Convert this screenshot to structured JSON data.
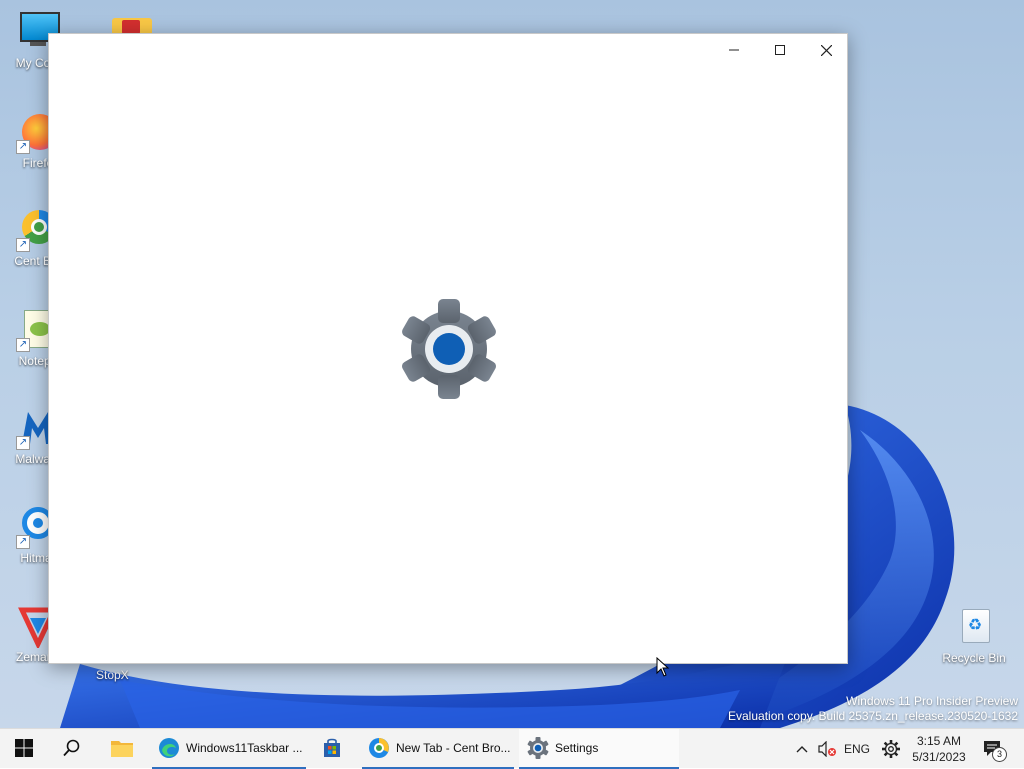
{
  "desktop": {
    "icons": [
      {
        "label": "My Com",
        "icon": "computer-icon"
      },
      {
        "label": "Firefo",
        "icon": "firefox-icon"
      },
      {
        "label": "Cent Bro",
        "icon": "cent-browser-icon"
      },
      {
        "label": "Notepa",
        "icon": "notepad-icon"
      },
      {
        "label": "Malware",
        "icon": "malwarebytes-icon"
      },
      {
        "label": "Hitmar",
        "icon": "hitmanpro-icon"
      },
      {
        "label": "Zemana",
        "icon": "zemana-icon"
      },
      {
        "label": "StopX",
        "icon": "folder-icon"
      },
      {
        "label": "Recycle Bin",
        "icon": "recycle-bin-icon"
      }
    ],
    "watermark": {
      "line1": "Windows 11 Pro Insider Preview",
      "line2": "Evaluation copy. Build 25375.zn_release.230520-1632"
    }
  },
  "window": {
    "title": "Settings",
    "splash_icon": "settings-gear-icon",
    "accent": "#0f5fb5"
  },
  "taskbar": {
    "start_icon": "windows-start-icon",
    "search_icon": "search-icon",
    "apps": [
      {
        "label": "",
        "icon": "file-explorer-icon"
      },
      {
        "label": "Windows11Taskbar ...",
        "icon": "edge-icon"
      },
      {
        "label": "",
        "icon": "microsoft-store-icon"
      },
      {
        "label": "New Tab - Cent Bro...",
        "icon": "cent-browser-icon"
      },
      {
        "label": "Settings",
        "icon": "settings-gear-icon"
      }
    ],
    "tray": {
      "language": "ENG",
      "time": "3:15 AM",
      "date": "5/31/2023",
      "notification_count": "3"
    }
  },
  "colors": {
    "taskbar": "#f3f3f3",
    "accent": "#2f6fbf",
    "bloom": "#1f56d6"
  }
}
